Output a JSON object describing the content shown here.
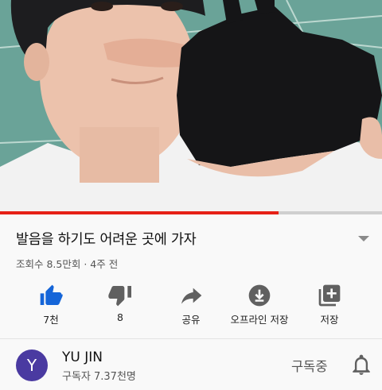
{
  "player": {
    "progress_fraction": 0.73,
    "accent_color": "#e62117"
  },
  "video": {
    "title": "발음을 하기도 어려운 곳에 가자",
    "meta": "조회수 8.5만회 · 4주 전"
  },
  "actions": [
    {
      "icon": "thumbs-up-icon",
      "label": "7천",
      "color": "#1565d8"
    },
    {
      "icon": "thumbs-down-icon",
      "label": "8",
      "color": "#606060"
    },
    {
      "icon": "share-icon",
      "label": "공유",
      "color": "#606060"
    },
    {
      "icon": "download-icon",
      "label": "오프라인 저장",
      "color": "#606060"
    },
    {
      "icon": "add-to-playlist-icon",
      "label": "저장",
      "color": "#606060"
    }
  ],
  "channel": {
    "avatar_letter": "Y",
    "avatar_color": "#4a3aa1",
    "name": "YU JIN",
    "subscribers": "구독자 7.37천명",
    "subscribe_label": "구독중",
    "notification_icon": "bell-icon"
  }
}
